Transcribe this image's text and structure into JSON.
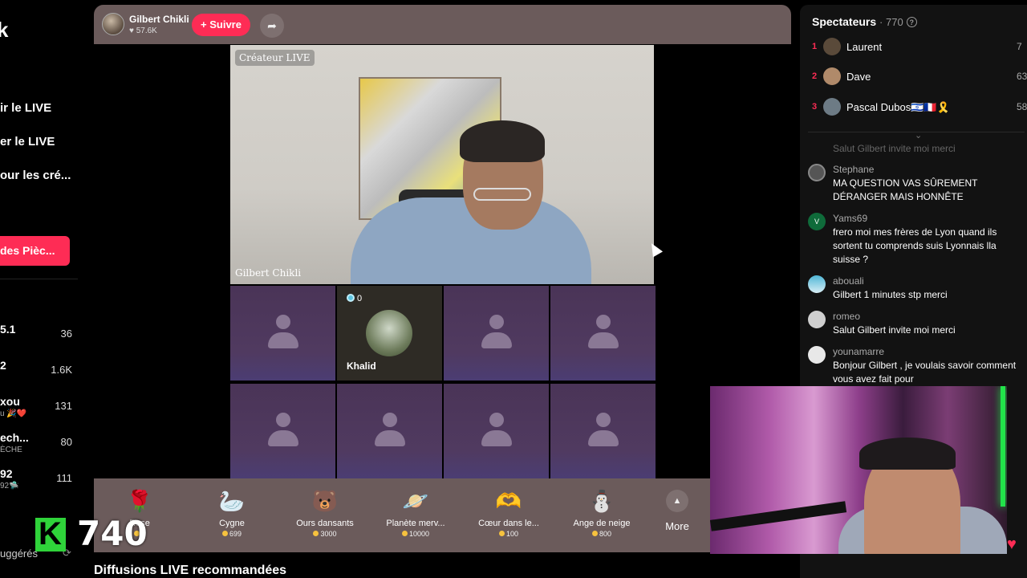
{
  "sidebar": {
    "logo": "k",
    "links": [
      "ir le LIVE",
      "er le LIVE",
      "our les cré..."
    ],
    "button_label": "des Pièc...",
    "rankings": [
      {
        "name": "5.1",
        "sub": "",
        "count": "36"
      },
      {
        "name": "2",
        "sub": "",
        "count": "1.6K"
      },
      {
        "name": "xou",
        "sub": "u 🎉❤️",
        "count": "131"
      },
      {
        "name": "ech...",
        "sub": "ÈCHE",
        "count": "80"
      },
      {
        "name": "92",
        "sub": "92🛸",
        "count": "111"
      }
    ],
    "suggested_label": "uggérés"
  },
  "live_header": {
    "host_name": "Gilbert Chikli",
    "host_likes": "♥ 57.6K",
    "follow_label": "+ Suivre",
    "share_icon": "share-arrow-icon"
  },
  "stage": {
    "creator_tag": "Créateur LIVE",
    "video_name": "Gilbert Chikli",
    "guests": [
      {
        "name": "",
        "active": false
      },
      {
        "name": "Khalid",
        "active": true,
        "badge": "0"
      },
      {
        "name": "",
        "active": false
      },
      {
        "name": "",
        "active": false
      },
      {
        "name": "",
        "active": false
      },
      {
        "name": "",
        "active": false
      },
      {
        "name": "",
        "active": false
      },
      {
        "name": "",
        "active": false
      }
    ]
  },
  "gifts": [
    {
      "name": "Rose",
      "price": "1",
      "icon": "🌹"
    },
    {
      "name": "Cygne",
      "price": "699",
      "icon": "🦢"
    },
    {
      "name": "Ours dansants",
      "price": "3000",
      "icon": "🐻"
    },
    {
      "name": "Planète merv...",
      "price": "10000",
      "icon": "🪐"
    },
    {
      "name": "Cœur dans le...",
      "price": "100",
      "icon": "🫶"
    },
    {
      "name": "Ange de neige",
      "price": "800",
      "icon": "⛄"
    }
  ],
  "more_label": "More",
  "recommended_title": "Diffusions LIVE recommandées",
  "overlay": {
    "k_letter": "K",
    "k_count": "740"
  },
  "spectators": {
    "title": "Spectateurs",
    "count": "· 770",
    "top": [
      {
        "rank": "1",
        "name": "Laurent",
        "score": "7",
        "color": "#5a4a3a"
      },
      {
        "rank": "2",
        "name": "Dave",
        "score": "63",
        "color": "#b08a6a"
      },
      {
        "rank": "3",
        "name": "Pascal Dubos🇮🇱🇫🇷🎗️",
        "score": "58",
        "color": "#6d7b85"
      }
    ],
    "faded_message": "Salut Gilbert invite moi merci",
    "chat": [
      {
        "user": "Stephane",
        "text": "MA QUESTION VAS SÛREMENT DÉRANGER MAIS HONNÊTE",
        "avatar_color": "#555",
        "avatar_letter": ""
      },
      {
        "user": "Yams69",
        "text": "frero moi mes frères de Lyon quand ils sortent tu comprends suis Lyonnais lla suisse ?",
        "avatar_color": "#0f6b3a",
        "avatar_letter": "V"
      },
      {
        "user": "abouali",
        "text": "Gilbert 1 minutes stp merci",
        "avatar_color": "#4fb6d6",
        "avatar_letter": ""
      },
      {
        "user": "romeo",
        "text": "Salut Gilbert invite moi merci",
        "avatar_color": "#cfcfcf",
        "avatar_letter": ""
      },
      {
        "user": "younamarre",
        "text": "Bonjour Gilbert , je voulais savoir comment vous avez fait pour",
        "avatar_color": "#e8e8e8",
        "avatar_letter": ""
      }
    ]
  }
}
